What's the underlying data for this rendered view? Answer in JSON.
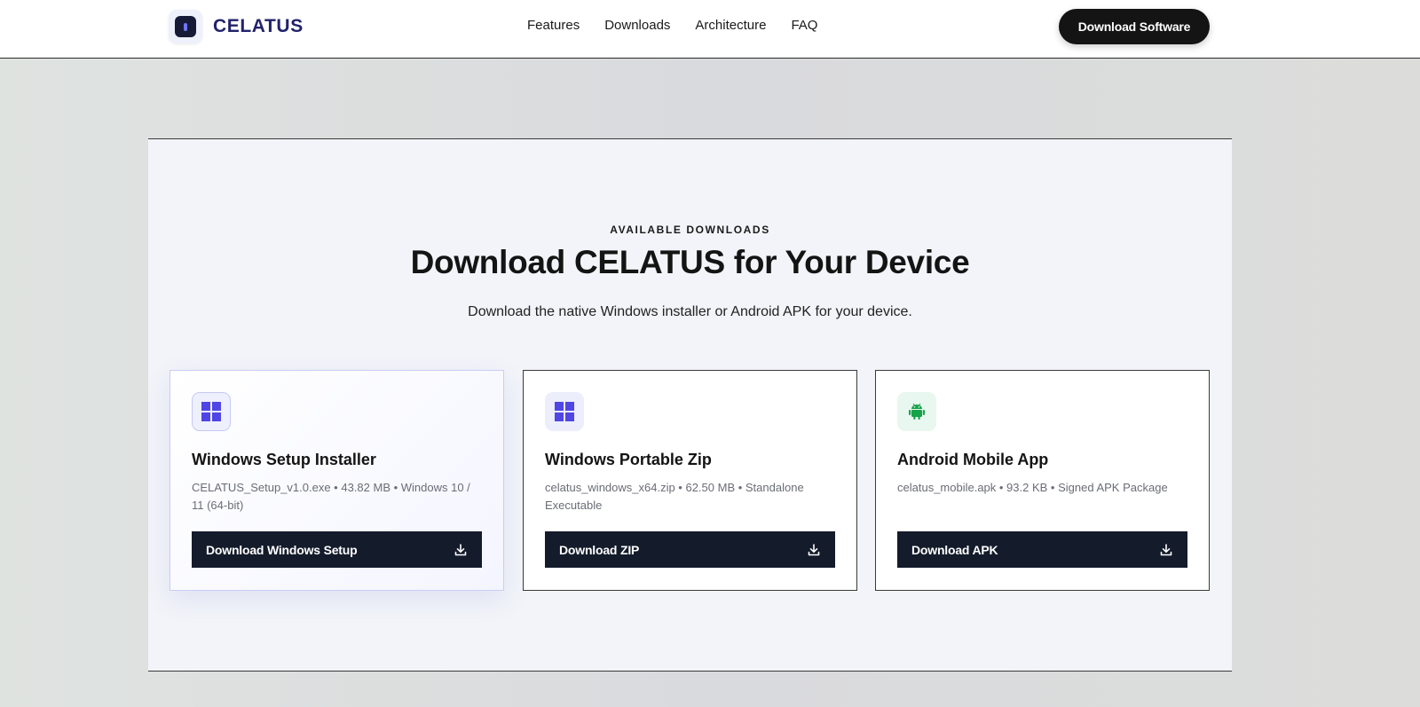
{
  "header": {
    "logo_text": "CELATUS",
    "nav": [
      "Features",
      "Downloads",
      "Architecture",
      "FAQ"
    ],
    "cta_label": "Download Software"
  },
  "section": {
    "eyebrow": "AVAILABLE DOWNLOADS",
    "title": "Download CELATUS for Your Device",
    "subtitle": "Download the native Windows installer or Android APK for your device."
  },
  "cards": [
    {
      "title": "Windows Setup Installer",
      "meta": "CELATUS_Setup_v1.0.exe • 43.82 MB • Windows 10 / 11 (64-bit)",
      "button": "Download Windows Setup",
      "icon": "windows-icon"
    },
    {
      "title": "Windows Portable Zip",
      "meta": "celatus_windows_x64.zip • 62.50 MB • Standalone Executable",
      "button": "Download ZIP",
      "icon": "windows-icon"
    },
    {
      "title": "Android Mobile App",
      "meta": "celatus_mobile.apk • 93.2 KB • Signed APK Package",
      "button": "Download APK",
      "icon": "android-icon"
    }
  ],
  "colors": {
    "brand": "#23226b",
    "windows_blue": "#4f46e5",
    "android_green": "#16a34a",
    "button_dark": "#141b2b"
  }
}
